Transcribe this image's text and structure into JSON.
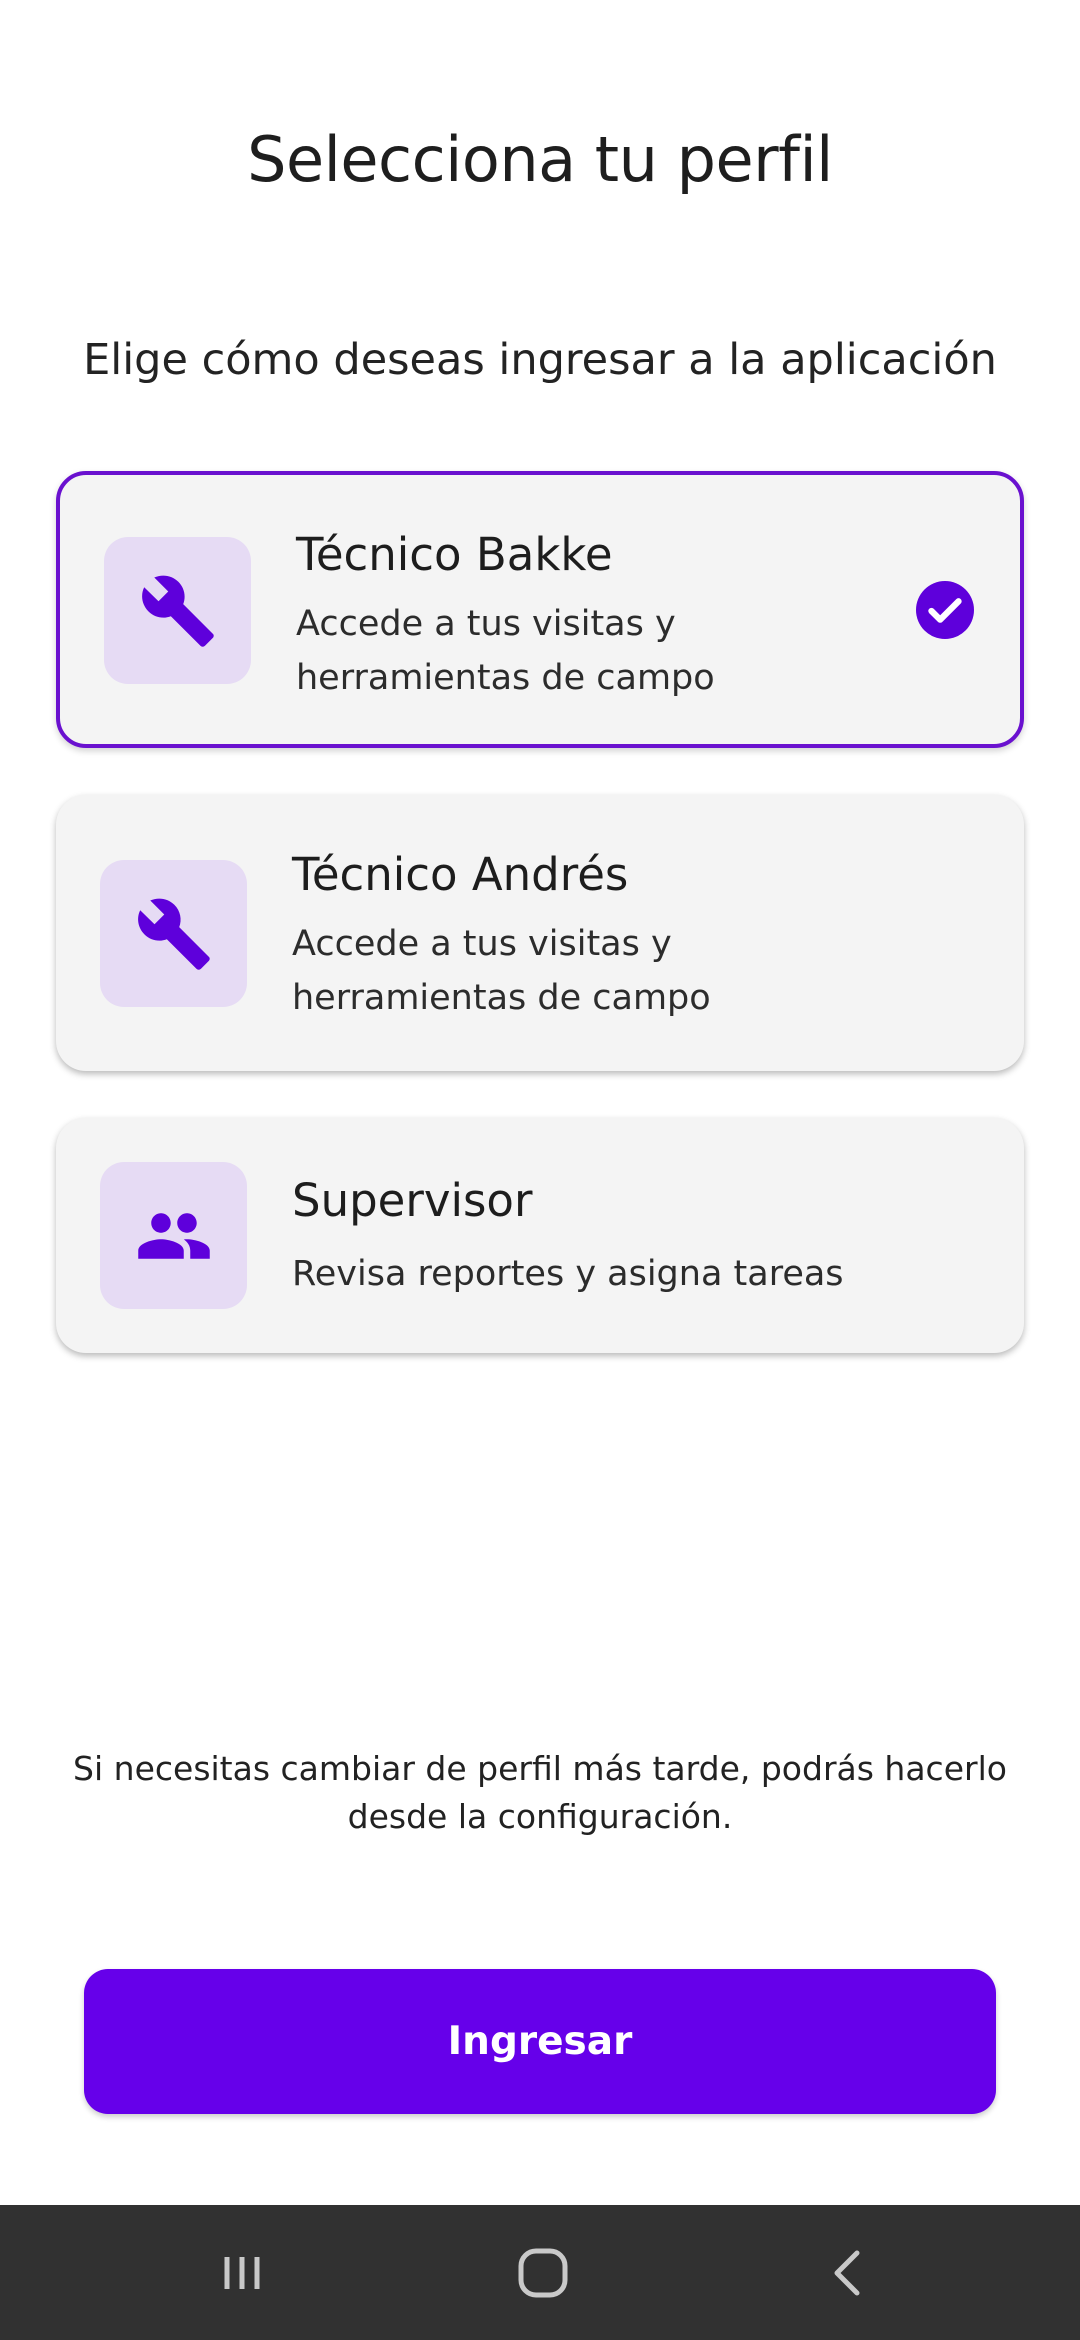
{
  "header": {
    "title": "Selecciona tu perfil",
    "subtitle": "Elige cómo deseas ingresar a la aplicación"
  },
  "profiles": [
    {
      "title": "Técnico Bakke",
      "description": "Accede a tus visitas y herramientas de campo",
      "icon": "wrench-icon",
      "selected": true
    },
    {
      "title": "Técnico Andrés",
      "description": "Accede a tus visitas y herramientas de campo",
      "icon": "wrench-icon",
      "selected": false
    },
    {
      "title": "Supervisor",
      "description": "Revisa reportes y asigna tareas",
      "icon": "group-icon",
      "selected": false
    }
  ],
  "footnote": "Si necesitas cambiar de perfil más tarde, podrás hacerlo desde la configuración.",
  "actions": {
    "submit_label": "Ingresar"
  },
  "system_nav": {
    "icons": [
      "recent-apps-icon",
      "home-icon",
      "back-icon"
    ]
  },
  "colors": {
    "accent": "#6600ea",
    "selected_border": "#6a11cf",
    "icon_background": "#e6dbf4",
    "card_background": "#f4f4f4",
    "nav_bar": "#313131"
  }
}
